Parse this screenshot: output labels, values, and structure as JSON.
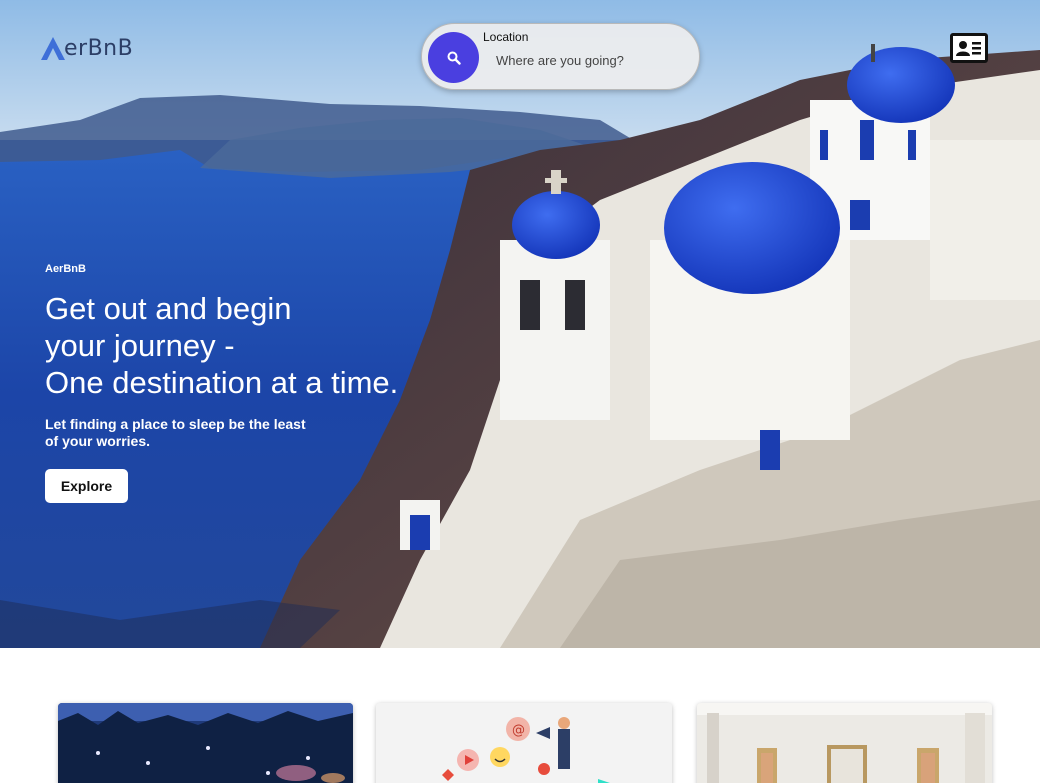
{
  "header": {
    "logo_text": "erBnB"
  },
  "search": {
    "label": "Location",
    "placeholder": "Where are you going?"
  },
  "hero": {
    "brand": "AerBnB",
    "headline_lines": [
      "Get out and begin",
      "your journey -",
      "One destination at a time."
    ],
    "subhead": "Let finding a place to sleep be the least of your worries.",
    "explore_label": "Explore"
  },
  "icons": {
    "search": "search-icon",
    "account": "contact-card-icon",
    "logo": "logo-icon"
  },
  "colors": {
    "accent": "#4a3fe0",
    "logo_blue": "#3e6fd8",
    "logo_text": "#2c3e66"
  }
}
